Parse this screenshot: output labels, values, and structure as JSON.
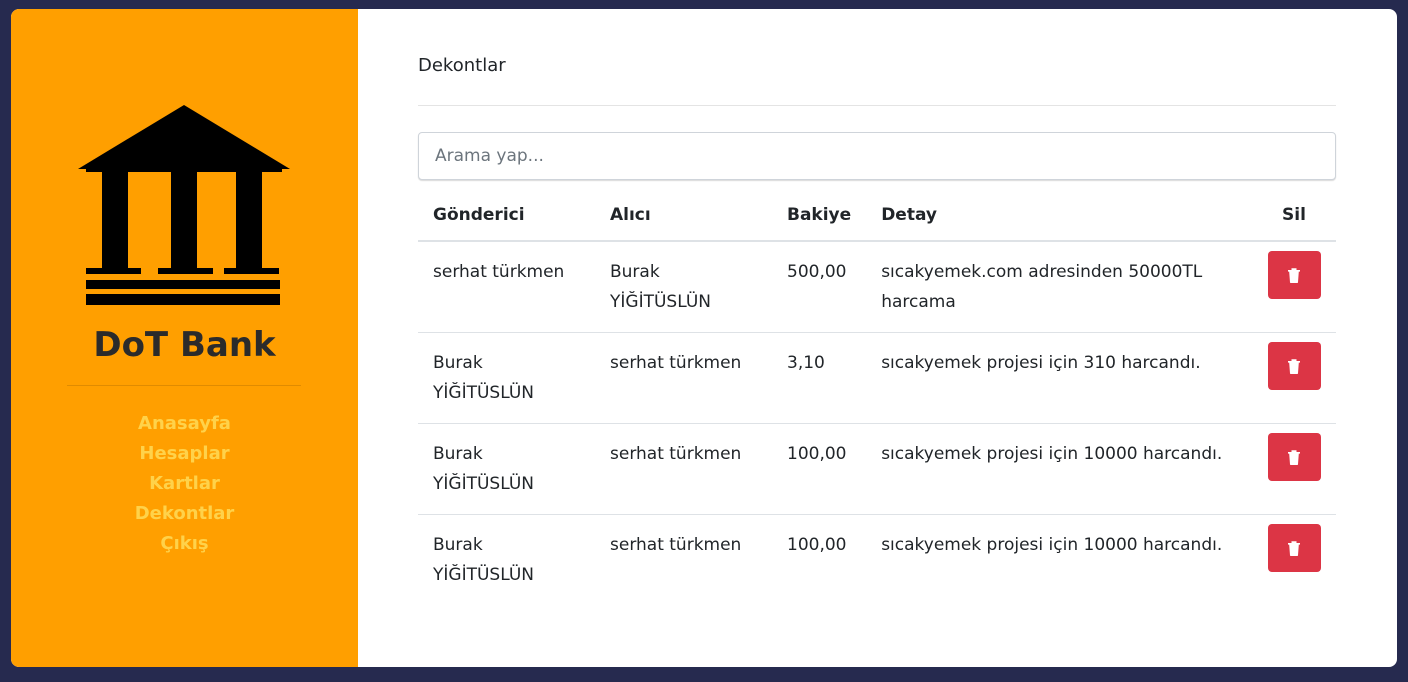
{
  "sidebar": {
    "brand": "DoT Bank",
    "nav": [
      "Anasayfa",
      "Hesaplar",
      "Kartlar",
      "Dekontlar",
      "Çıkış"
    ]
  },
  "main": {
    "title": "Dekontlar",
    "search": {
      "placeholder": "Arama yap..."
    },
    "table": {
      "headers": {
        "sender": "Gönderici",
        "receiver": "Alıcı",
        "amount": "Bakiye",
        "detail": "Detay",
        "delete": "Sil"
      },
      "rows": [
        {
          "sender": "serhat türkmen",
          "receiver": "Burak YİĞİTÜSLÜN",
          "amount": "500,00",
          "detail": "sıcakyemek.com adresinden 50000TL harcama"
        },
        {
          "sender": "Burak YİĞİTÜSLÜN",
          "receiver": "serhat türkmen",
          "amount": "3,10",
          "detail": "sıcakyemek projesi için 310 harcandı."
        },
        {
          "sender": "Burak YİĞİTÜSLÜN",
          "receiver": "serhat türkmen",
          "amount": "100,00",
          "detail": "sıcakyemek projesi için 10000 harcandı."
        },
        {
          "sender": "Burak YİĞİTÜSLÜN",
          "receiver": "serhat türkmen",
          "amount": "100,00",
          "detail": "sıcakyemek projesi için 10000 harcandı."
        }
      ]
    }
  },
  "icons": {
    "logo": "bank-icon",
    "delete": "trash-icon"
  },
  "colors": {
    "sidebar": "#ff9f00",
    "nav_link": "#ffd24a",
    "delete_button": "#dc3545",
    "outer_background": "#262a4f"
  }
}
